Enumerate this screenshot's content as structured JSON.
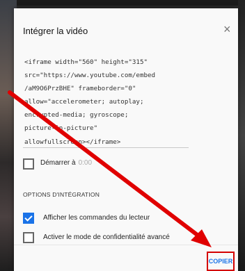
{
  "dialog": {
    "title": "Intégrer la vidéo",
    "close_icon": "×",
    "embed_code": "<iframe width=\"560\" height=\"315\"\nsrc=\"https://www.youtube.com/embed\n/aM9O6PrzBHE\" frameborder=\"0\"\nallow=\"accelerometer; autoplay;\nencrypted-media; gyroscope;\npicture-in-picture\"\nallowfullscreen></iframe>",
    "start_at": {
      "label": "Démarrer à",
      "value": "0:00",
      "checked": false
    },
    "options_title": "OPTIONS D'INTÉGRATION",
    "options": [
      {
        "label": "Afficher les commandes du lecteur",
        "checked": true
      },
      {
        "label": "Activer le mode de confidentialité avancé",
        "checked": false
      }
    ],
    "copy_label": "COPIER"
  },
  "annotation": {
    "arrow_color": "#e00000"
  }
}
